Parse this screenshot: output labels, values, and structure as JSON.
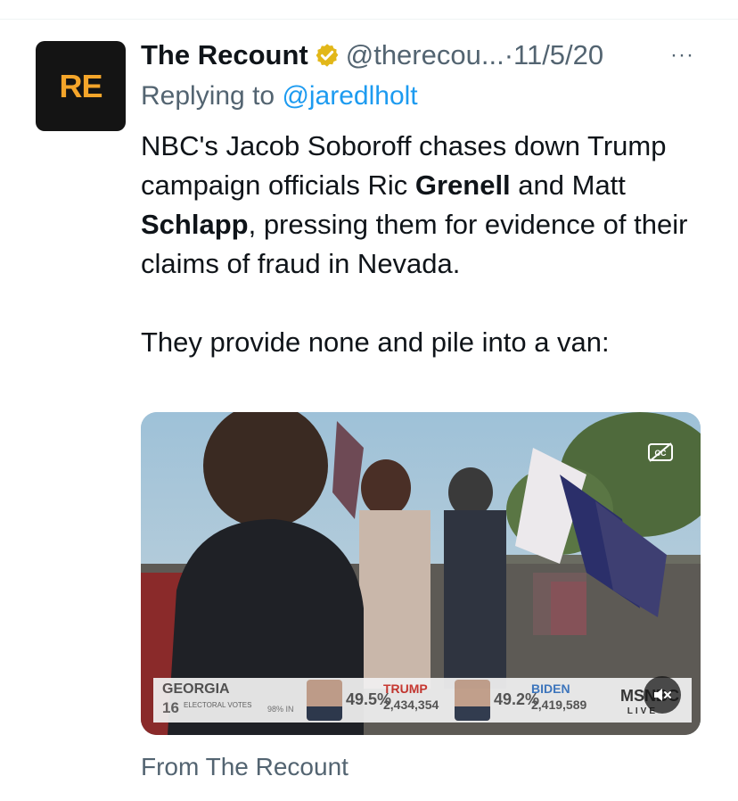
{
  "tweet": {
    "avatar_text": "RE",
    "name": "The Recount",
    "handle": "@therecou...",
    "separator": "·",
    "date": "11/5/20",
    "more": "···",
    "replying_prefix": "Replying to",
    "replying_to": "@jaredlholt",
    "body": {
      "t1": "NBC's Jacob Soboroff chases down Trump campaign officials Ric ",
      "b1": "Grenell",
      "t2": " and Matt ",
      "b2": "Schlapp",
      "t3": ", pressing them for evidence of their claims of fraud in Nevada.",
      "p2": "They provide none and pile into a van:"
    },
    "source": "From The Recount"
  },
  "media": {
    "captions_icon": "closed-captions-icon",
    "mute_icon": "speaker-muted-icon",
    "overlay": {
      "state": "GEORGIA",
      "electoral_votes": "16",
      "electoral_label": "ELECTORAL VOTES",
      "reporting": "98% IN",
      "trump_pct": "49.5%",
      "trump_name": "TRUMP",
      "trump_votes": "2,434,354",
      "biden_pct": "49.2%",
      "biden_name": "BIDEN",
      "biden_votes": "2,419,589",
      "network": "MSNBC",
      "live": "LIVE"
    }
  },
  "colors": {
    "link": "#1d9bf0",
    "secondary_text": "#536471",
    "verified_badge": "#e2b719",
    "avatar_bg": "#141414",
    "avatar_text": "#f4a52a",
    "trump_red": "#c8312b",
    "biden_blue": "#3b78c4"
  }
}
